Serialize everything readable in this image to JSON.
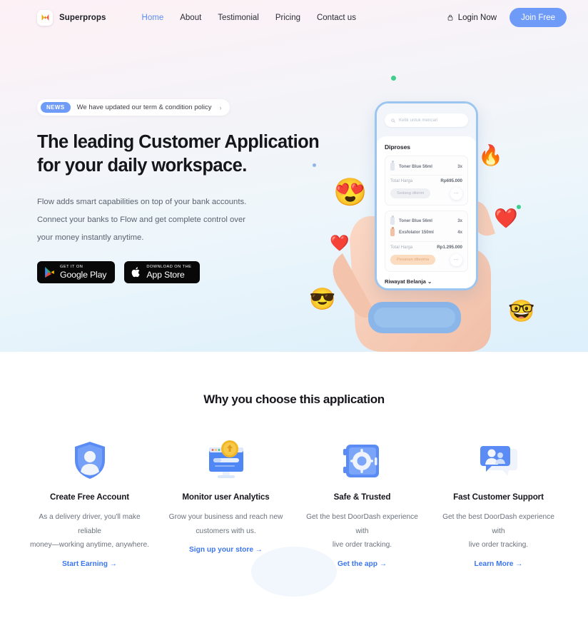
{
  "nav": {
    "brand": "Superprops",
    "logo_icon": "superprops-logo-icon",
    "links": [
      {
        "label": "Home",
        "active": true
      },
      {
        "label": "About",
        "active": false
      },
      {
        "label": "Testimonial",
        "active": false
      },
      {
        "label": "Pricing",
        "active": false
      },
      {
        "label": "Contact us",
        "active": false
      }
    ],
    "login_label": "Login Now",
    "login_icon": "lock-icon",
    "join_label": "Join Free",
    "accent_color": "#6f9bf8"
  },
  "hero": {
    "news_tag": "NEWS",
    "news_text": "We have updated our term & condition policy",
    "news_chevron": "›",
    "headline_line1": "The leading Customer Application",
    "headline_line2": "for your daily workspace.",
    "subcopy_line1": "Flow adds smart capabilities on top of your bank accounts.",
    "subcopy_line2": "Connect your banks to Flow and get complete control over",
    "subcopy_line3": "your money instantly anytime.",
    "stores": [
      {
        "small": "GET IT ON",
        "big": "Google Play",
        "icon": "google-play-icon"
      },
      {
        "small": "Download on the",
        "big": "App Store",
        "icon": "apple-icon"
      }
    ],
    "decorations": {
      "emojis": [
        "😍",
        "🔥",
        "❤️",
        "❤️",
        "😎",
        "🤓"
      ],
      "dot_colors": [
        "#3ecf8e",
        "#3ecf8e",
        "#6f9bf8",
        "#8fb6e8"
      ]
    }
  },
  "phone": {
    "search_placeholder": "Ketik untuk mencari",
    "search_icon": "search-icon",
    "section_title": "Diproses",
    "orders": [
      {
        "items": [
          {
            "name": "Toner Blue 56ml",
            "qty": "3x",
            "color": "grey"
          }
        ],
        "total_label": "Total Harga",
        "total_value": "Rp695.000",
        "status": "Sedang dikirim",
        "status_type": "pending",
        "more_icon": "more-dots-icon"
      },
      {
        "items": [
          {
            "name": "Toner Blue 56ml",
            "qty": "3x",
            "color": "grey"
          },
          {
            "name": "Exsfolator 150ml",
            "qty": "4x",
            "color": "orange"
          }
        ],
        "total_label": "Total Harga",
        "total_value": "Rp1.295.000",
        "status": "Pesanan diterima",
        "status_type": "accepted",
        "more_icon": "more-dots-icon"
      }
    ],
    "history_label": "Riwayat Belanja",
    "history_chevron": "⌄"
  },
  "features": {
    "heading": "Why you choose this application",
    "items": [
      {
        "icon": "shield-person-icon",
        "title": "Create Free Account",
        "desc_line1": "As a delivery driver, you'll make reliable",
        "desc_line2": "money—working anytime, anywhere.",
        "link": "Start Earning →"
      },
      {
        "icon": "monitor-coin-icon",
        "title": "Monitor user Analytics",
        "desc_line1": "Grow your business and reach new",
        "desc_line2": "customers with us.",
        "link": "Sign up your store →"
      },
      {
        "icon": "safe-vault-icon",
        "title": "Safe & Trusted",
        "desc_line1": "Get the best DoorDash experience with",
        "desc_line2": "live order tracking.",
        "link": "Get the app →"
      },
      {
        "icon": "chat-people-icon",
        "title": "Fast Customer Support",
        "desc_line1": "Get the best DoorDash experience with",
        "desc_line2": "live order tracking.",
        "link": "Learn More →"
      }
    ],
    "link_color": "#3b76ef"
  }
}
